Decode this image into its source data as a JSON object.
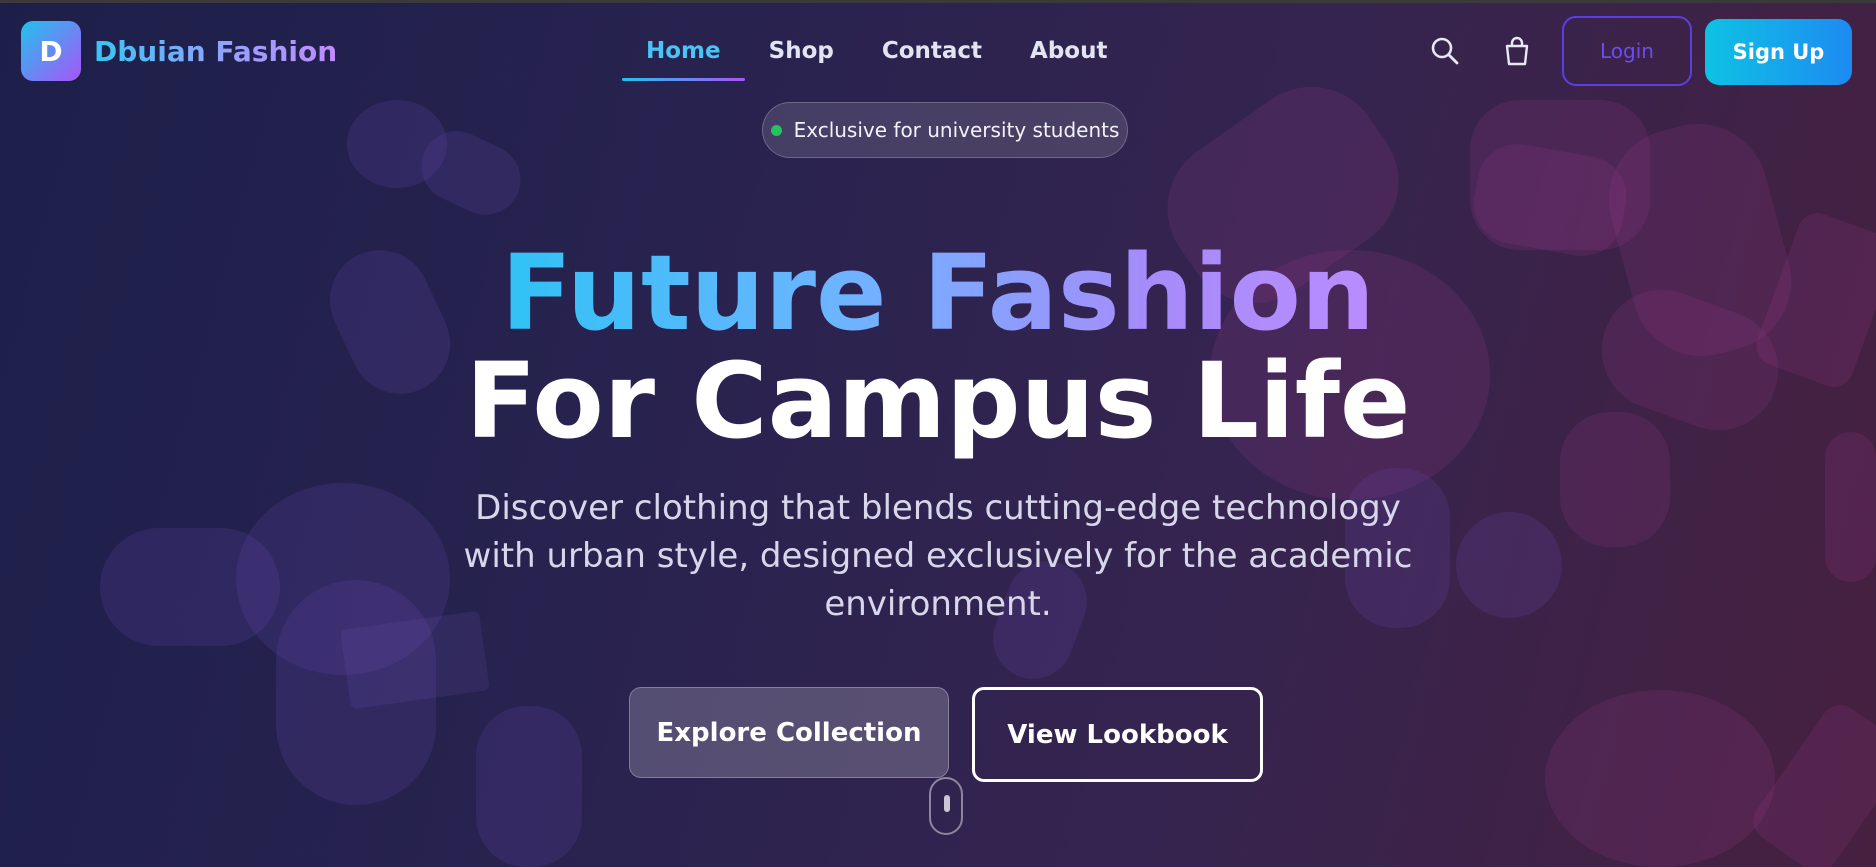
{
  "brand": {
    "logo_letter": "D",
    "name": "Dbuian Fashion"
  },
  "nav": {
    "links": [
      {
        "label": "Home",
        "active": true
      },
      {
        "label": "Shop",
        "active": false
      },
      {
        "label": "Contact",
        "active": false
      },
      {
        "label": "About",
        "active": false
      }
    ],
    "icons": [
      "search-icon",
      "shopping-bag-icon"
    ],
    "login_label": "Login",
    "signup_label": "Sign Up"
  },
  "hero": {
    "badge_text": "Exclusive for university students",
    "title_line1": "Future Fashion",
    "title_line2": "For Campus Life",
    "subtitle": "Discover clothing that blends cutting-edge technology with urban style, designed exclusively for the academic environment.",
    "primary_cta": "Explore Collection",
    "secondary_cta": "View Lookbook"
  },
  "colors": {
    "accent_cyan": "#22c1ee",
    "accent_purple": "#a855f7",
    "status_green": "#22c55e",
    "login_border": "#5b3fe0"
  }
}
